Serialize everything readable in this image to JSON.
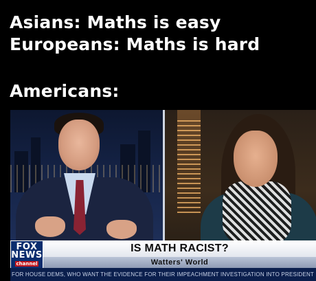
{
  "captions": {
    "line1": "Asians: Maths is easy",
    "line2": "Europeans: Maths is hard",
    "line3": "Americans:"
  },
  "broadcast": {
    "network_logo": {
      "line1": "FOX",
      "line2": "NEWS",
      "line3": "channel"
    },
    "headline": "IS MATH RACIST?",
    "show_name": "Watters' World",
    "ticker": "FOR HOUSE DEMS, WHO WANT THE EVIDENCE FOR THEIR IMPEACHMENT INVESTIGATION INTO PRESIDENT"
  },
  "colors": {
    "background": "#000000",
    "caption_text": "#ffffff",
    "network_blue": "#0b2d6e",
    "network_red": "#c4161c",
    "chyron": "#ffffff"
  }
}
